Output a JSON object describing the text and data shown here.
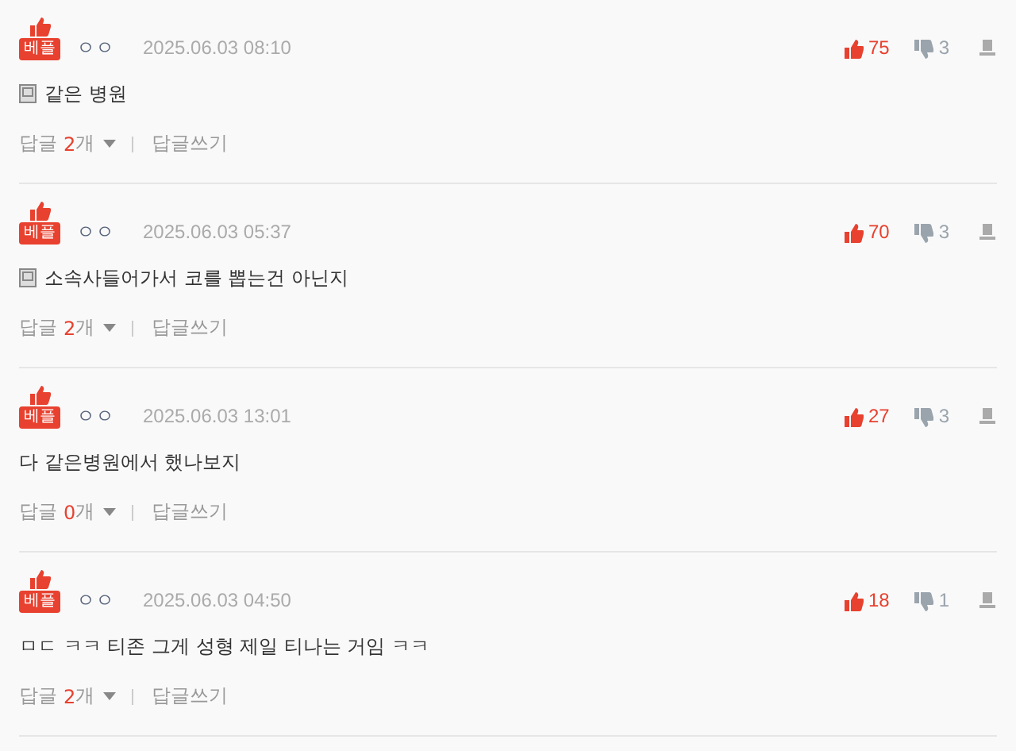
{
  "comments": [
    {
      "badge": "베플",
      "author": "ㅇㅇ",
      "date": "2025.06.03 08:10",
      "memo": true,
      "text": "같은 병원",
      "likes": "75",
      "dislikes": "3",
      "reply_label": "답글",
      "reply_count": "2",
      "reply_unit": "개",
      "write_reply": "답글쓰기"
    },
    {
      "badge": "베플",
      "author": "ㅇㅇ",
      "date": "2025.06.03 05:37",
      "memo": true,
      "text": "소속사들어가서 코를 뽑는건 아닌지",
      "likes": "70",
      "dislikes": "3",
      "reply_label": "답글",
      "reply_count": "2",
      "reply_unit": "개",
      "write_reply": "답글쓰기"
    },
    {
      "badge": "베플",
      "author": "ㅇㅇ",
      "date": "2025.06.03 13:01",
      "memo": false,
      "text": "다 같은병원에서 했나보지",
      "likes": "27",
      "dislikes": "3",
      "reply_label": "답글",
      "reply_count": "0",
      "reply_unit": "개",
      "write_reply": "답글쓰기"
    },
    {
      "badge": "베플",
      "author": "ㅇㅇ",
      "date": "2025.06.03 04:50",
      "memo": false,
      "text": "ㅁㄷ ㅋㅋ 티존 그게 성형 제일 티나는 거임 ㅋㅋ",
      "likes": "18",
      "dislikes": "1",
      "reply_label": "답글",
      "reply_count": "2",
      "reply_unit": "개",
      "write_reply": "답글쓰기"
    }
  ]
}
